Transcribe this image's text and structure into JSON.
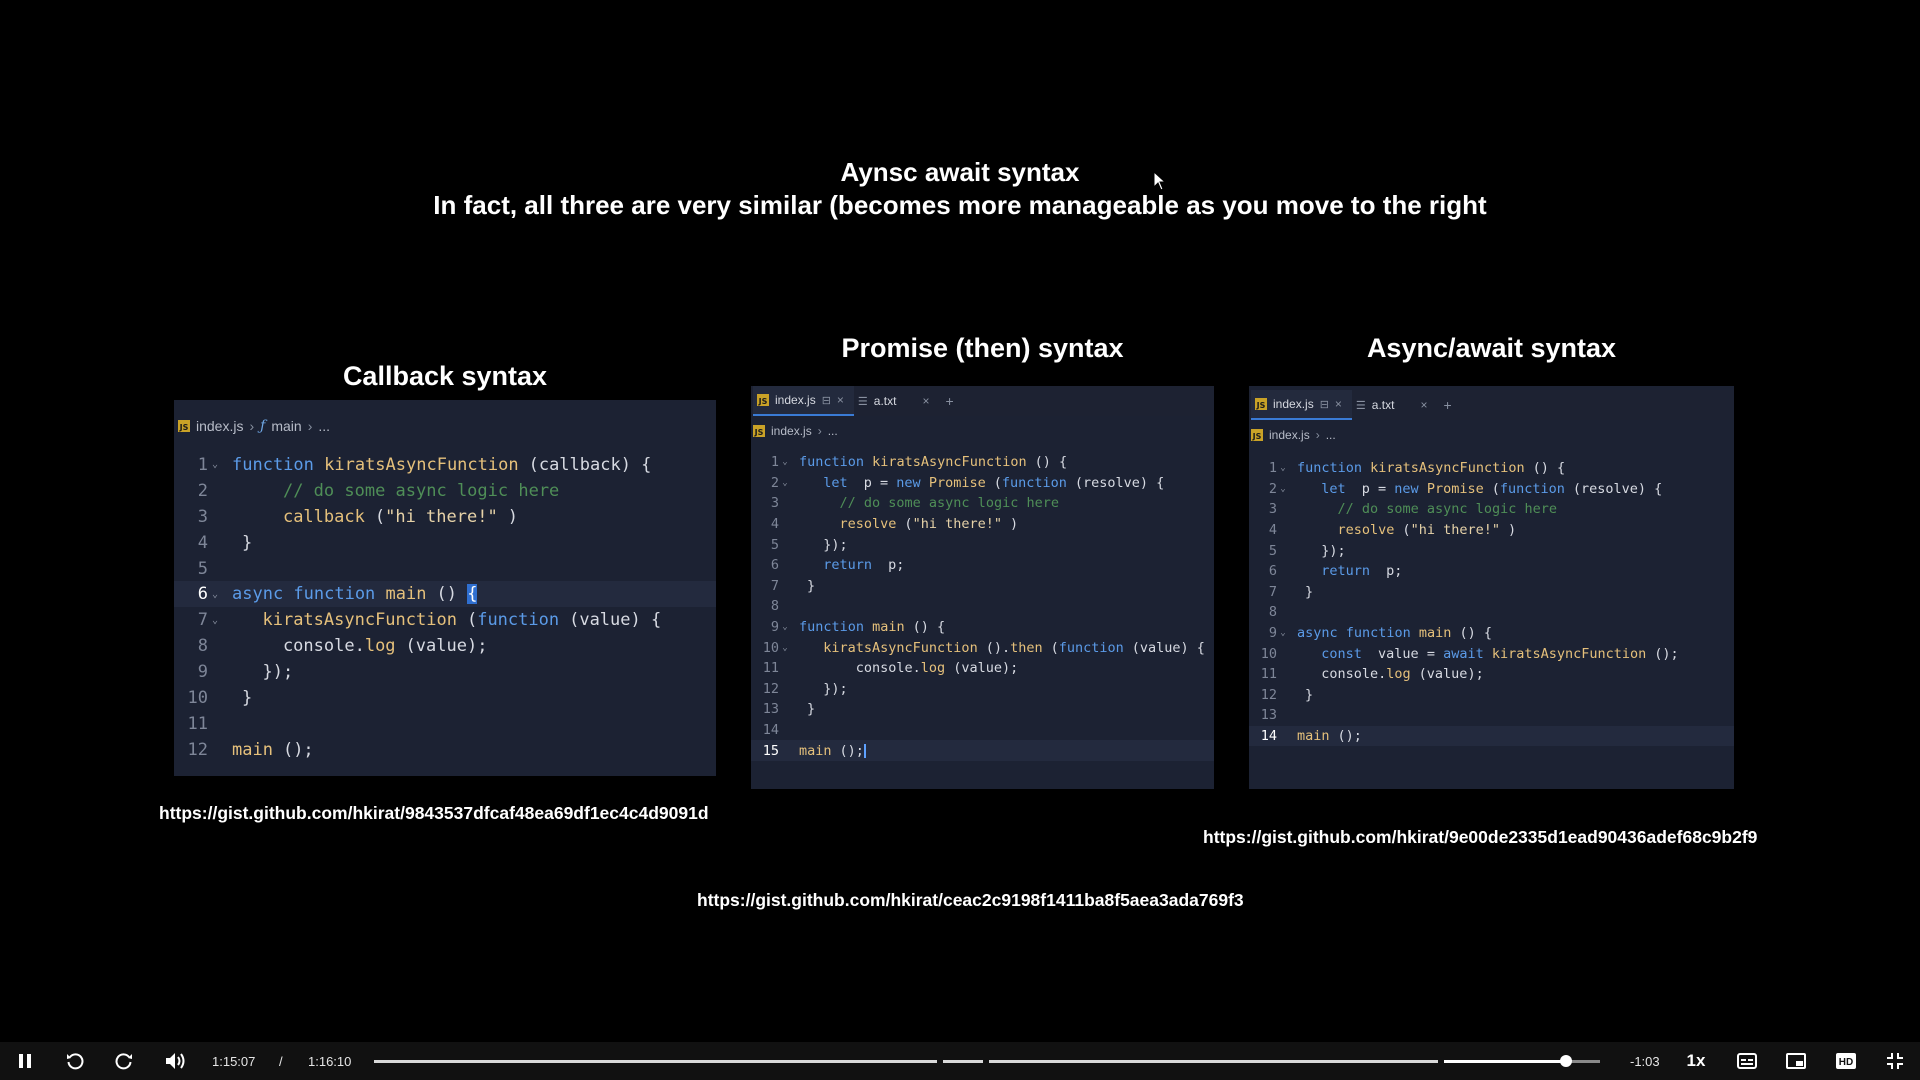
{
  "slide": {
    "title": "Aynsc await syntax",
    "subtitle": "In fact, all three are very similar (becomes more manageable as you move to the right",
    "panels": [
      {
        "heading": "Callback syntax",
        "breadcrumb": {
          "file": "index.js",
          "symbol": "main",
          "more": "..."
        },
        "url": "https://gist.github.com/hkirat/9843537dfcaf48ea69df1ec4c4d9091d"
      },
      {
        "heading": "Promise (then) syntax",
        "tabs": [
          {
            "label": "index.js"
          },
          {
            "label": "a.txt"
          }
        ],
        "breadcrumb": {
          "file": "index.js",
          "more": "..."
        },
        "url": "https://gist.github.com/hkirat/ceac2c9198f1411ba8f5aea3ada769f3"
      },
      {
        "heading": "Async/await syntax",
        "tabs": [
          {
            "label": "index.js"
          },
          {
            "label": "a.txt"
          }
        ],
        "breadcrumb": {
          "file": "index.js",
          "more": "..."
        },
        "url": "https://gist.github.com/hkirat/9e00de2335d1ead90436adef68c9b2f9"
      }
    ]
  },
  "code": {
    "callback": [
      {
        "n": "1",
        "fold": true,
        "tokens": [
          [
            "kw",
            "function "
          ],
          [
            "fn",
            "kiratsAsyncFunction"
          ],
          [
            "src",
            "(callback) {"
          ]
        ]
      },
      {
        "n": "2",
        "tokens": [
          [
            "src",
            "    "
          ],
          [
            "cm",
            "// do some async logic here"
          ]
        ]
      },
      {
        "n": "3",
        "tokens": [
          [
            "src",
            "    "
          ],
          [
            "fn",
            "callback"
          ],
          [
            "src",
            "("
          ],
          [
            "str",
            "\"hi there!\""
          ],
          [
            "src",
            ")"
          ]
        ]
      },
      {
        "n": "4",
        "tokens": [
          [
            "src",
            "}"
          ]
        ]
      },
      {
        "n": "5",
        "tokens": []
      },
      {
        "n": "6",
        "fold": true,
        "current": true,
        "tokens": [
          [
            "kw",
            "async function "
          ],
          [
            "fn",
            "main"
          ],
          [
            "src",
            "() "
          ],
          [
            "box",
            "{"
          ]
        ]
      },
      {
        "n": "7",
        "fold": true,
        "tokens": [
          [
            "src",
            "  "
          ],
          [
            "fn",
            "kiratsAsyncFunction"
          ],
          [
            "src",
            "("
          ],
          [
            "kw",
            "function"
          ],
          [
            "src",
            "(value) {"
          ]
        ]
      },
      {
        "n": "8",
        "tokens": [
          [
            "src",
            "    console."
          ],
          [
            "fn",
            "log"
          ],
          [
            "src",
            "(value);"
          ]
        ]
      },
      {
        "n": "9",
        "tokens": [
          [
            "src",
            "  });"
          ]
        ]
      },
      {
        "n": "10",
        "tokens": [
          [
            "src",
            "}"
          ]
        ]
      },
      {
        "n": "11",
        "tokens": []
      },
      {
        "n": "12",
        "tokens": [
          [
            "fn",
            "main"
          ],
          [
            "src",
            "();"
          ]
        ]
      }
    ],
    "promise": [
      {
        "n": "1",
        "fold": true,
        "tokens": [
          [
            "kw",
            "function "
          ],
          [
            "fn",
            "kiratsAsyncFunction"
          ],
          [
            "src",
            "() {"
          ]
        ]
      },
      {
        "n": "2",
        "fold": true,
        "tokens": [
          [
            "src",
            "  "
          ],
          [
            "kw",
            "let "
          ],
          [
            "src",
            "p = "
          ],
          [
            "kw",
            "new "
          ],
          [
            "fn",
            "Promise"
          ],
          [
            "src",
            "("
          ],
          [
            "kw",
            "function"
          ],
          [
            "src",
            "(resolve) {"
          ]
        ]
      },
      {
        "n": "3",
        "tokens": [
          [
            "src",
            "    "
          ],
          [
            "cm",
            "// do some async logic here"
          ]
        ]
      },
      {
        "n": "4",
        "tokens": [
          [
            "src",
            "    "
          ],
          [
            "fn",
            "resolve"
          ],
          [
            "src",
            "("
          ],
          [
            "str",
            "\"hi there!\""
          ],
          [
            "src",
            ")"
          ]
        ]
      },
      {
        "n": "5",
        "tokens": [
          [
            "src",
            "  });"
          ]
        ]
      },
      {
        "n": "6",
        "tokens": [
          [
            "src",
            "  "
          ],
          [
            "kw",
            "return "
          ],
          [
            "src",
            "p;"
          ]
        ]
      },
      {
        "n": "7",
        "tokens": [
          [
            "src",
            "}"
          ]
        ]
      },
      {
        "n": "8",
        "tokens": []
      },
      {
        "n": "9",
        "fold": true,
        "tokens": [
          [
            "kw",
            "function "
          ],
          [
            "fn",
            "main"
          ],
          [
            "src",
            "() {"
          ]
        ]
      },
      {
        "n": "10",
        "fold": true,
        "tokens": [
          [
            "src",
            "  "
          ],
          [
            "fn",
            "kiratsAsyncFunction"
          ],
          [
            "src",
            "()."
          ],
          [
            "fn",
            "then"
          ],
          [
            "src",
            "("
          ],
          [
            "kw",
            "function"
          ],
          [
            "src",
            "(value) {"
          ]
        ]
      },
      {
        "n": "11",
        "tokens": [
          [
            "src",
            "      console."
          ],
          [
            "fn",
            "log"
          ],
          [
            "src",
            "(value);"
          ]
        ]
      },
      {
        "n": "12",
        "tokens": [
          [
            "src",
            "  });"
          ]
        ]
      },
      {
        "n": "13",
        "tokens": [
          [
            "src",
            "}"
          ]
        ]
      },
      {
        "n": "14",
        "tokens": []
      },
      {
        "n": "15",
        "current": true,
        "tokens": [
          [
            "fn",
            "main"
          ],
          [
            "src",
            "();"
          ],
          [
            "caret",
            ""
          ]
        ]
      }
    ],
    "asyncawait": [
      {
        "n": "1",
        "fold": true,
        "tokens": [
          [
            "kw",
            "function "
          ],
          [
            "fn",
            "kiratsAsyncFunction"
          ],
          [
            "src",
            "() {"
          ]
        ]
      },
      {
        "n": "2",
        "fold": true,
        "tokens": [
          [
            "src",
            "  "
          ],
          [
            "kw",
            "let "
          ],
          [
            "src",
            "p = "
          ],
          [
            "kw",
            "new "
          ],
          [
            "fn",
            "Promise"
          ],
          [
            "src",
            "("
          ],
          [
            "kw",
            "function"
          ],
          [
            "src",
            "(resolve) {"
          ]
        ]
      },
      {
        "n": "3",
        "tokens": [
          [
            "src",
            "    "
          ],
          [
            "cm",
            "// do some async logic here"
          ]
        ]
      },
      {
        "n": "4",
        "tokens": [
          [
            "src",
            "    "
          ],
          [
            "fn",
            "resolve"
          ],
          [
            "src",
            "("
          ],
          [
            "str",
            "\"hi there!\""
          ],
          [
            "src",
            ")"
          ]
        ]
      },
      {
        "n": "5",
        "tokens": [
          [
            "src",
            "  });"
          ]
        ]
      },
      {
        "n": "6",
        "tokens": [
          [
            "src",
            "  "
          ],
          [
            "kw",
            "return "
          ],
          [
            "src",
            "p;"
          ]
        ]
      },
      {
        "n": "7",
        "tokens": [
          [
            "src",
            "}"
          ]
        ]
      },
      {
        "n": "8",
        "tokens": []
      },
      {
        "n": "9",
        "fold": true,
        "tokens": [
          [
            "kw",
            "async function "
          ],
          [
            "fn",
            "main"
          ],
          [
            "src",
            "() {"
          ]
        ]
      },
      {
        "n": "10",
        "tokens": [
          [
            "src",
            "  "
          ],
          [
            "kw",
            "const "
          ],
          [
            "src",
            "value = "
          ],
          [
            "kw",
            "await "
          ],
          [
            "fn",
            "kiratsAsyncFunction"
          ],
          [
            "src",
            "();"
          ]
        ]
      },
      {
        "n": "11",
        "tokens": [
          [
            "src",
            "  console."
          ],
          [
            "fn",
            "log"
          ],
          [
            "src",
            "(value);"
          ]
        ]
      },
      {
        "n": "12",
        "tokens": [
          [
            "src",
            "}"
          ]
        ]
      },
      {
        "n": "13",
        "tokens": []
      },
      {
        "n": "14",
        "current": true,
        "tokens": [
          [
            "fn",
            "main"
          ],
          [
            "src",
            "();"
          ]
        ]
      }
    ]
  },
  "player": {
    "current_time": "1:15:07",
    "separator": "/",
    "duration": "1:16:10",
    "remaining": "-1:03",
    "speed": "1x",
    "progress": 0.9722,
    "icons": {
      "play_pause": "pause-icon",
      "rewind": "rewind-icon",
      "forward": "forward-icon",
      "volume": "volume-icon",
      "captions": "captions-icon",
      "pip": "picture-in-picture-icon",
      "quality": "hd-icon",
      "fullscreen": "exit-fullscreen-icon"
    }
  }
}
